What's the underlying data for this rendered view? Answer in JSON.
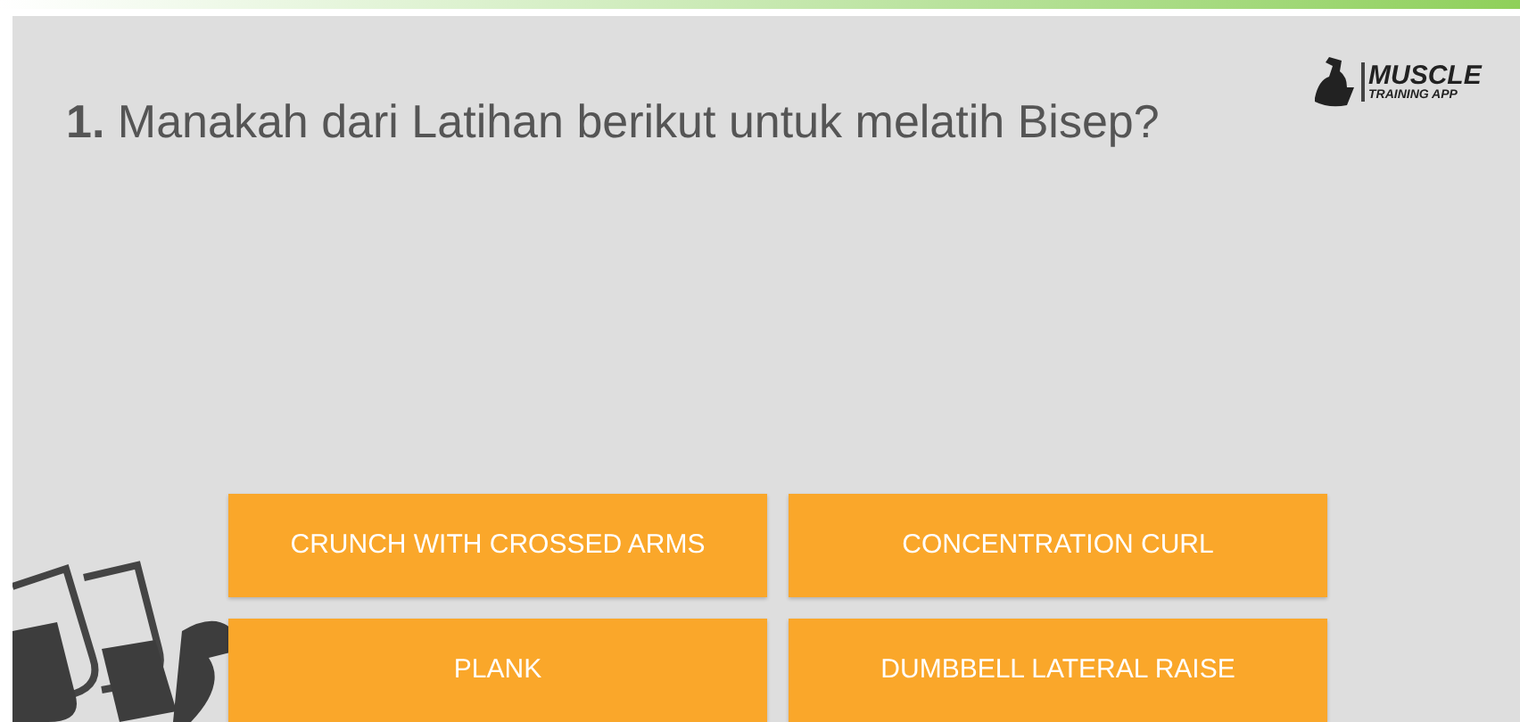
{
  "question": "**1.** Manakah dari Latihan berikut untuk melatih Bisep?",
  "logo": {
    "title": "MUSCLE",
    "subtitle": "TRAINING APP"
  },
  "answers": [
    {
      "label": "CRUNCH WITH CROSSED ARMS"
    },
    {
      "label": "CONCENTRATION CURL"
    },
    {
      "label": "PLANK"
    },
    {
      "label": "DUMBBELL LATERAL RAISE"
    }
  ]
}
